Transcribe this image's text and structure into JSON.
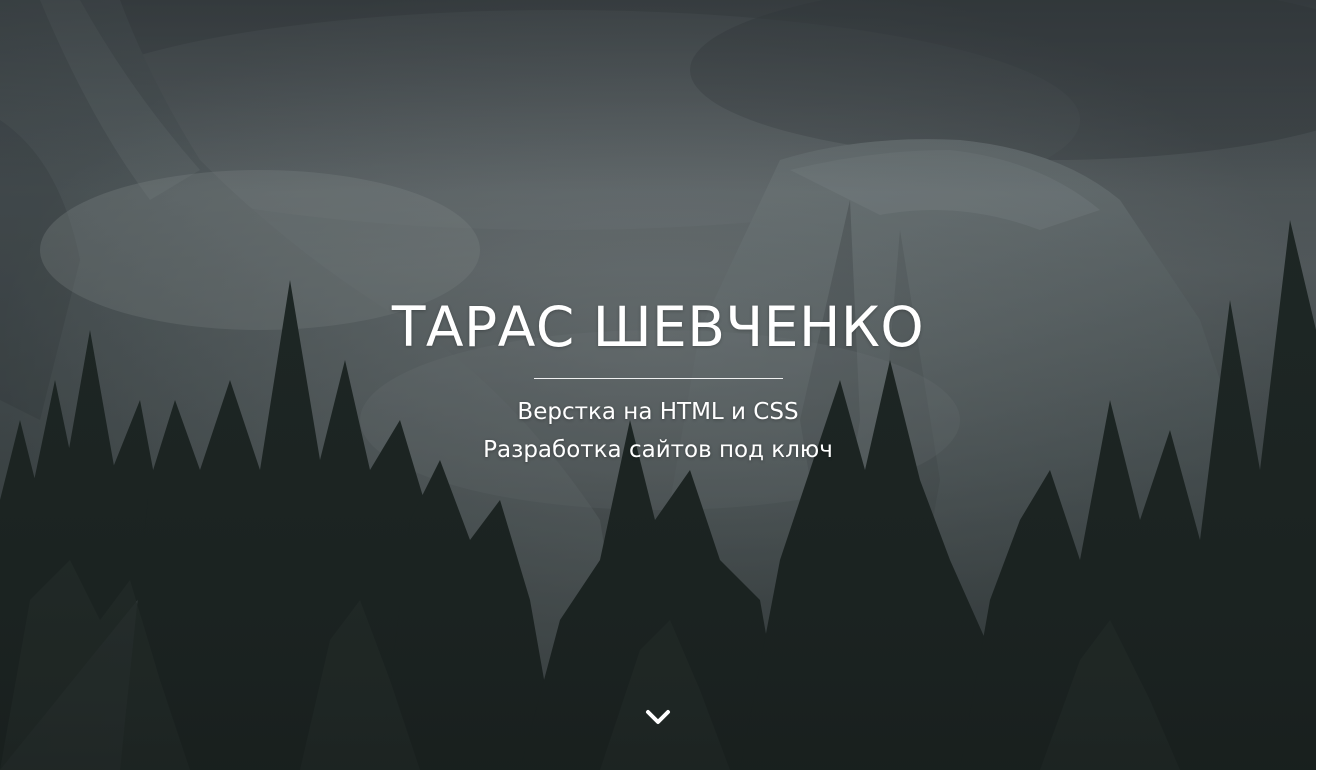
{
  "hero": {
    "title": "ТАРАС ШЕВЧЕНКО",
    "subtitle_line1": "Верстка на HTML и CSS",
    "subtitle_line2": "Разработка сайтов под ключ",
    "scroll_icon": "chevron-down-icon"
  },
  "colors": {
    "text": "#ffffff",
    "overlay": "#2f3a3d",
    "forest": "#1f2a24",
    "mist": "#9aa3a6"
  }
}
